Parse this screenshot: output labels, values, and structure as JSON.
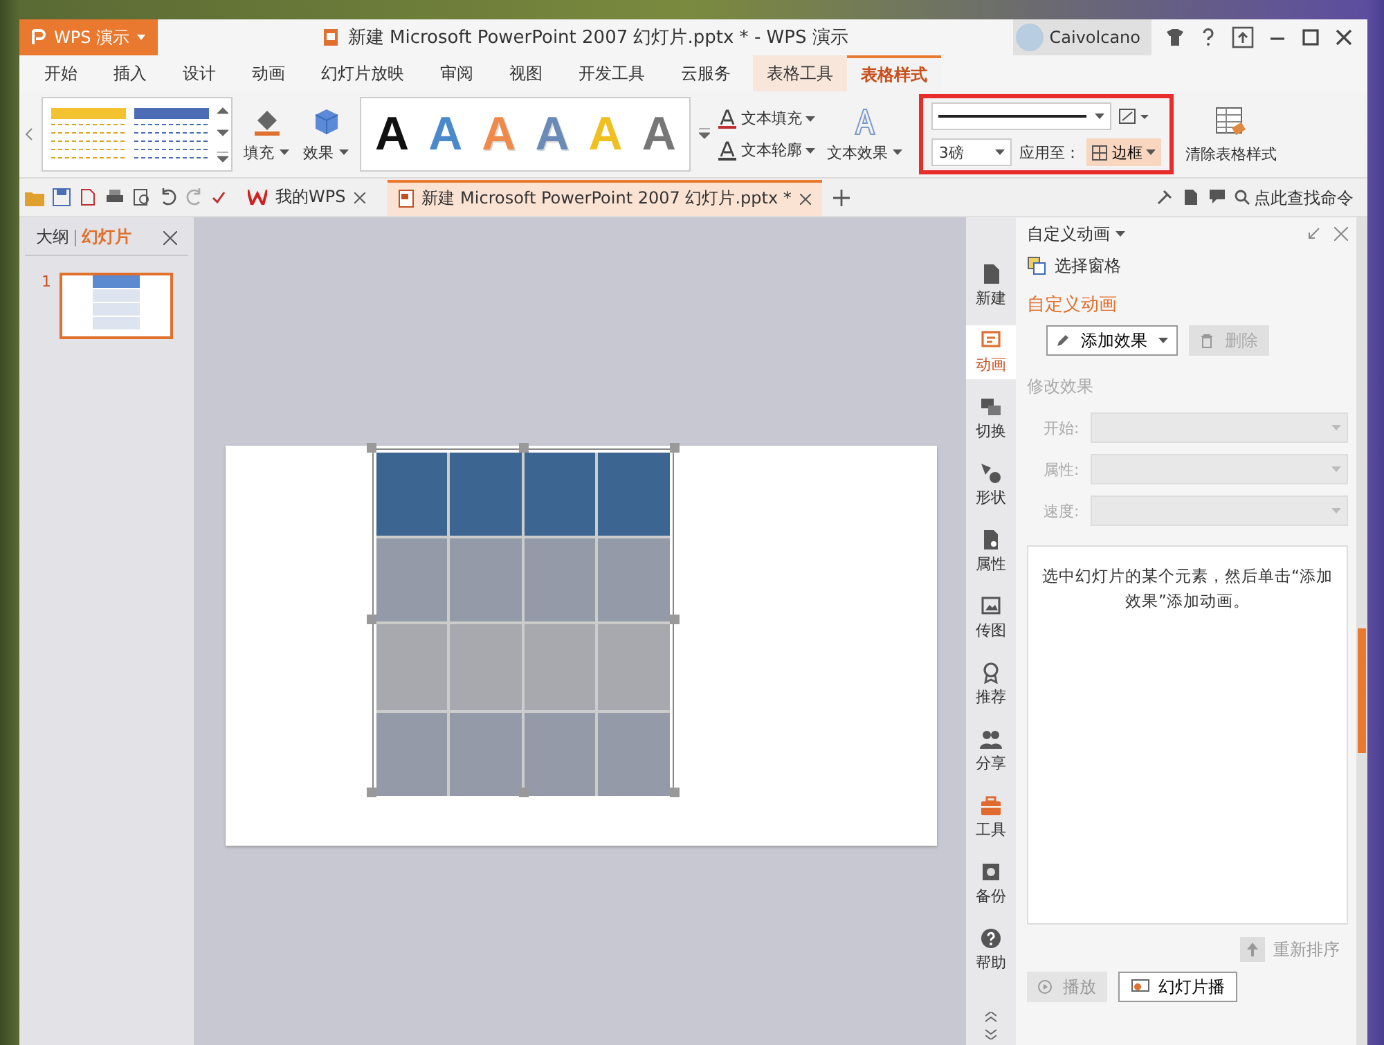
{
  "app_button": {
    "label": "WPS 演示"
  },
  "window": {
    "title": "新建 Microsoft PowerPoint 2007 幻灯片.pptx * - WPS 演示"
  },
  "user": {
    "name": "Caivolcano"
  },
  "menu_tabs": [
    {
      "label": "开始",
      "selected": false,
      "kind": "tab"
    },
    {
      "label": "插入",
      "selected": false,
      "kind": "tab"
    },
    {
      "label": "设计",
      "selected": false,
      "kind": "tab"
    },
    {
      "label": "动画",
      "selected": false,
      "kind": "tab"
    },
    {
      "label": "幻灯片放映",
      "selected": false,
      "kind": "tab"
    },
    {
      "label": "审阅",
      "selected": false,
      "kind": "tab"
    },
    {
      "label": "视图",
      "selected": false,
      "kind": "tab"
    },
    {
      "label": "开发工具",
      "selected": false,
      "kind": "tab"
    },
    {
      "label": "云服务",
      "selected": false,
      "kind": "tab"
    },
    {
      "label": "表格工具",
      "selected": false,
      "kind": "context"
    },
    {
      "label": "表格样式",
      "selected": true,
      "kind": "context"
    }
  ],
  "ribbon": {
    "fill": "填充",
    "effect": "效果",
    "text_styles": [
      {
        "label": "A",
        "color": "#111111",
        "kind": "solid"
      },
      {
        "label": "A",
        "color": "#4a8acb",
        "kind": "solid"
      },
      {
        "label": "A",
        "color": "#f08a4b",
        "kind": "outline"
      },
      {
        "label": "A",
        "color": "#6a8ab8",
        "kind": "outline"
      },
      {
        "label": "A",
        "color": "#f0c020",
        "kind": "solid"
      },
      {
        "label": "A",
        "color": "#777777",
        "kind": "solid"
      }
    ],
    "text_fill": "文本填充",
    "text_outline": "文本轮廓",
    "text_effect": "文本效果",
    "line_weight": "3磅",
    "apply_to": "应用至：",
    "border": "边框",
    "clear_style": "清除表格样式"
  },
  "doc_tabs": [
    {
      "label": "我的WPS",
      "selected": false
    },
    {
      "label": "新建 Microsoft PowerPoint 2007 幻灯片.pptx *",
      "selected": true
    }
  ],
  "search": {
    "placeholder": "点此查找命令"
  },
  "left_panel": {
    "tabs": [
      {
        "label": "大纲",
        "selected": false
      },
      {
        "label": "幻灯片",
        "selected": true
      }
    ],
    "thumbnails": [
      {
        "number": "1",
        "selected": true
      }
    ]
  },
  "side_strip": [
    {
      "label": "新建",
      "selected": false
    },
    {
      "label": "动画",
      "selected": true
    },
    {
      "label": "切换",
      "selected": false
    },
    {
      "label": "形状",
      "selected": false
    },
    {
      "label": "属性",
      "selected": false
    },
    {
      "label": "传图",
      "selected": false
    },
    {
      "label": "推荐",
      "selected": false
    },
    {
      "label": "分享",
      "selected": false
    },
    {
      "label": "工具",
      "selected": false
    },
    {
      "label": "备份",
      "selected": false
    },
    {
      "label": "帮助",
      "selected": false
    }
  ],
  "task_pane": {
    "title": "自定义动画",
    "select_pane": "选择窗格",
    "section": "自定义动画",
    "add_effect": "添加效果",
    "delete": {
      "label": "删除",
      "disabled": true
    },
    "modify": "修改效果",
    "fields": [
      {
        "label": "开始:",
        "disabled": true
      },
      {
        "label": "属性:",
        "disabled": true
      },
      {
        "label": "速度:",
        "disabled": true
      }
    ],
    "hint": "选中幻灯片的某个元素，然后单击“添加效果”添加动画。",
    "reorder": "重新排序",
    "play": "播放",
    "slideshow": "幻灯片播"
  }
}
